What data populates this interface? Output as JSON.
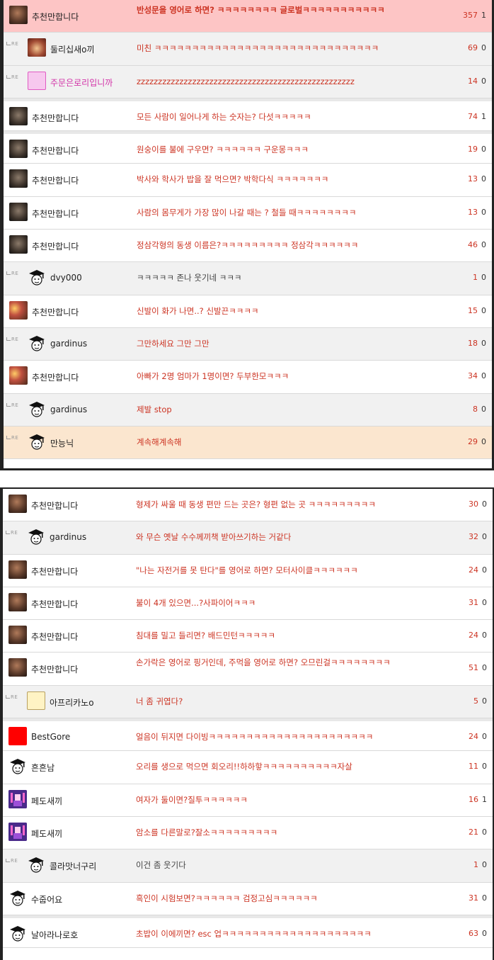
{
  "panel1": [
    {
      "reply": false,
      "avatar": "face",
      "nick": "추천만합니다",
      "title": "반성문을 영어로 하면? ㅋㅋㅋㅋㅋㅋㅋㅋ 글로벌ㅋㅋㅋㅋㅋㅋㅋㅋㅋㅋㅋ",
      "comments": "357",
      "votes": "1",
      "style": "hl-pink",
      "wrap": true,
      "bold": true
    },
    {
      "reply": true,
      "avatar": "monk",
      "nick": "둘리십새o끼",
      "title": "미친 ㅋㅋㅋㅋㅋㅋㅋㅋㅋㅋㅋㅋㅋㅋㅋㅋㅋㅋㅋㅋㅋㅋㅋㅋㅋㅋㅋㅋㅋㅋ",
      "comments": "69",
      "votes": "0"
    },
    {
      "reply": true,
      "avatar": "pink",
      "nick": "주문은로리입니까",
      "title": "zzzzzzzzzzzzzzzzzzzzzzzzzzzzzzzzzzzzzzzzzzzzzzzzzzz",
      "comments": "14",
      "votes": "0",
      "pink": true
    },
    {
      "reply": false,
      "avatar": "face2",
      "nick": "추천만합니다",
      "title": "모든 사람이 일어나게 하는 숫자는? 다섯ㅋㅋㅋㅋㅋ",
      "comments": "74",
      "votes": "1",
      "style": "gap"
    },
    {
      "reply": false,
      "avatar": "face2",
      "nick": "추천만합니다",
      "title": "원숭이를 불에 구우면? ㅋㅋㅋㅋㅋㅋ 구운몽ㅋㅋㅋ",
      "comments": "19",
      "votes": "0",
      "style": "gap"
    },
    {
      "reply": false,
      "avatar": "face2",
      "nick": "추천만합니다",
      "title": "박사와 학사가 밥을 잘 먹으면? 박학다식 ㅋㅋㅋㅋㅋㅋㅋ",
      "comments": "13",
      "votes": "0"
    },
    {
      "reply": false,
      "avatar": "face2",
      "nick": "추천만합니다",
      "title": "사람의 몸무게가 가장 많이 나갈 때는 ? 철들 때ㅋㅋㅋㅋㅋㅋㅋㅋ",
      "comments": "13",
      "votes": "0"
    },
    {
      "reply": false,
      "avatar": "face2",
      "nick": "추천만합니다",
      "title": "정삼각형의 동생 이름은?ㅋㅋㅋㅋㅋㅋㅋㅋㅋ 정삼각ㅋㅋㅋㅋㅋㅋ",
      "comments": "46",
      "votes": "0"
    },
    {
      "reply": true,
      "avatar": "grad",
      "nick": "dvy000",
      "title": "ㅋㅋㅋㅋㅋ 존나 웃기네 ㅋㅋㅋ",
      "comments": "1",
      "votes": "0",
      "muted": true
    },
    {
      "reply": false,
      "avatar": "flower",
      "nick": "추천만합니다",
      "title": "신발이 화가 나면..? 신발끈ㅋㅋㅋㅋ",
      "comments": "15",
      "votes": "0"
    },
    {
      "reply": true,
      "avatar": "grad",
      "nick": "gardinus",
      "title": "그만하세요 그만 그만",
      "comments": "18",
      "votes": "0"
    },
    {
      "reply": false,
      "avatar": "flower",
      "nick": "추천만합니다",
      "title": "아빠가 2명 엄마가 1명이면? 두부한모ㅋㅋㅋ",
      "comments": "34",
      "votes": "0"
    },
    {
      "reply": true,
      "avatar": "grad",
      "nick": "gardinus",
      "title": "제발 stop",
      "comments": "8",
      "votes": "0"
    },
    {
      "reply": true,
      "avatar": "grad",
      "nick": "만능닉",
      "title": "계속해계속해",
      "comments": "29",
      "votes": "0",
      "style": "hl-peach"
    }
  ],
  "panel2": [
    {
      "reply": false,
      "avatar": "face",
      "nick": "추천만합니다",
      "title": "형제가 싸울 때 동생 편만 드는 곳은? 형편 없는 곳 ㅋㅋㅋㅋㅋㅋㅋㅋㅋ",
      "comments": "30",
      "votes": "0"
    },
    {
      "reply": true,
      "avatar": "grad",
      "nick": "gardinus",
      "title": "와 무슨 옛날 수수께끼책 받아쓰기하는 거같다",
      "comments": "32",
      "votes": "0"
    },
    {
      "reply": false,
      "avatar": "face",
      "nick": "추천만합니다",
      "title": "\"나는 자전거를 못 탄다\"를 영어로 하면? 모터사이클ㅋㅋㅋㅋㅋㅋ",
      "comments": "24",
      "votes": "0"
    },
    {
      "reply": false,
      "avatar": "face",
      "nick": "추천만합니다",
      "title": "불이 4개 있으면...?사파이어ㅋㅋㅋ",
      "comments": "31",
      "votes": "0"
    },
    {
      "reply": false,
      "avatar": "face",
      "nick": "추천만합니다",
      "title": "침대를 밀고 들리면? 배드민턴ㅋㅋㅋㅋㅋ",
      "comments": "24",
      "votes": "0"
    },
    {
      "reply": false,
      "avatar": "face",
      "nick": "추천만합니다",
      "title": "손가락은 영어로 핑거인데, 주먹을 영어로 하면? 오므린걸ㅋㅋㅋㅋㅋㅋㅋㅋ",
      "comments": "51",
      "votes": "0",
      "wrap": true
    },
    {
      "reply": true,
      "avatar": "note",
      "nick": "아프리카노o",
      "title": "너 좀 귀엽다?",
      "comments": "5",
      "votes": "0"
    },
    {
      "reply": false,
      "avatar": "red",
      "nick": "BestGore",
      "title": "얼음이 뒤지면 다이빙ㅋㅋㅋㅋㅋㅋㅋㅋㅋㅋㅋㅋㅋㅋㅋㅋㅋㅋㅋㅋㅋㅋ",
      "comments": "24",
      "votes": "0",
      "style": "gap"
    },
    {
      "reply": false,
      "avatar": "grad",
      "nick": "흔흔남",
      "title": "오리를 생으로 먹으면 회오리!!하하핳ㅋㅋㅋㅋㅋㅋㅋㅋㅋㅋ자살",
      "comments": "11",
      "votes": "0"
    },
    {
      "reply": false,
      "avatar": "devil",
      "nick": "페도새끼",
      "title": "여자가 둘이면?질투ㅋㅋㅋㅋㅋㅋ",
      "comments": "16",
      "votes": "1"
    },
    {
      "reply": false,
      "avatar": "devil",
      "nick": "페도새끼",
      "title": "암소를 다른말로?잘소ㅋㅋㅋㅋㅋㅋㅋㅋㅋ",
      "comments": "21",
      "votes": "0"
    },
    {
      "reply": true,
      "avatar": "grad",
      "nick": "콜라맛너구리",
      "title": "이건 좀 웃기다",
      "comments": "1",
      "votes": "0",
      "muted": true
    },
    {
      "reply": false,
      "avatar": "grad",
      "nick": "수줍어요",
      "title": "흑인이 시험보면?ㅋㅋㅋㅋㅋㅋ 검정고심ㅋㅋㅋㅋㅋㅋ",
      "comments": "31",
      "votes": "0"
    },
    {
      "reply": false,
      "avatar": "grad",
      "nick": "날아라나로호",
      "title": "초밥이 이에끼면? esc 업ㅋㅋㅋㅋㅋㅋㅋㅋㅋㅋㅋㅋㅋㅋㅋㅋㅋㅋㅋㅋ",
      "comments": "63",
      "votes": "0",
      "style": "gap"
    }
  ],
  "labels": {
    "re": "RE"
  }
}
